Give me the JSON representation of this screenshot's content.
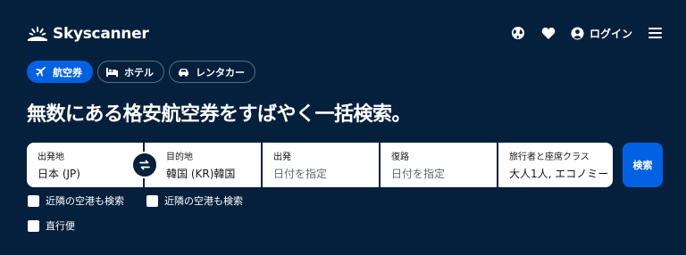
{
  "brand": {
    "name": "Skyscanner"
  },
  "header": {
    "login_label": "ログイン",
    "icons": [
      "globe-icon",
      "heart-icon",
      "user-icon",
      "hamburger-menu-icon"
    ]
  },
  "tabs": [
    {
      "label": "航空券",
      "icon": "plane-icon",
      "active": true
    },
    {
      "label": "ホテル",
      "icon": "bed-icon",
      "active": false
    },
    {
      "label": "レンタカー",
      "icon": "car-icon",
      "active": false
    }
  ],
  "headline": "無数にある格安航空券をすばやく一括検索。",
  "search": {
    "origin": {
      "label": "出発地",
      "value": "日本 (JP)"
    },
    "destination": {
      "label": "目的地",
      "value": "韓国 (KR)韓国"
    },
    "depart": {
      "label": "出発",
      "placeholder": "日付を指定"
    },
    "return": {
      "label": "復路",
      "placeholder": "日付を指定"
    },
    "travellers": {
      "label": "旅行者と座席クラス",
      "value": "大人1人, エコノミー"
    },
    "search_button": "検索"
  },
  "checkboxes": {
    "nearby_origin": "近隣の空港も検索",
    "nearby_destination": "近隣の空港も検索",
    "direct_only": "直行便"
  },
  "colors": {
    "background": "#05203c",
    "accent": "#0062e3",
    "text": "#ffffff"
  }
}
